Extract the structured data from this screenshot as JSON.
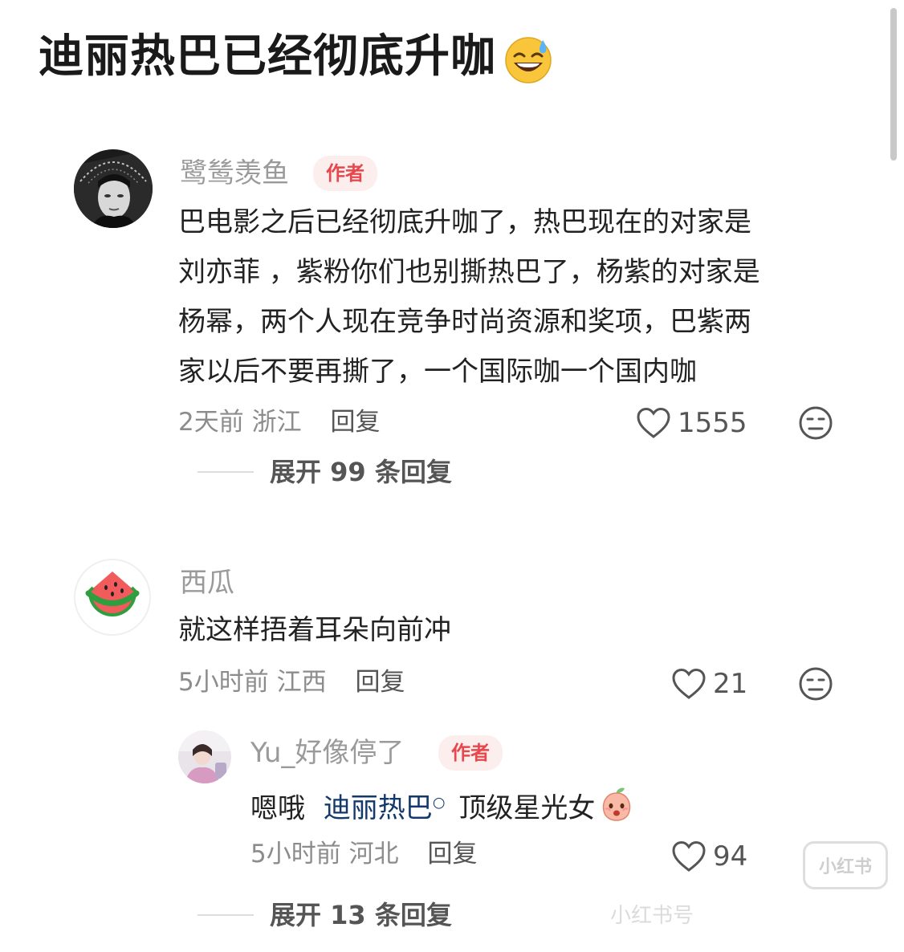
{
  "post": {
    "title": "迪丽热巴已经彻底升咖",
    "title_emoji": "sweat-smile-emoji"
  },
  "comments": [
    {
      "username": "鹭鸶羡鱼",
      "badge": "作者",
      "lines": [
        "巴电影之后已经彻底升咖了，热巴现在的对家是",
        "刘亦菲 ，紫粉你们也别撕热巴了，杨紫的对家是",
        "杨幂，两个人现在竞争时尚资源和奖项，巴紫两",
        "家以后不要再撕了，一个国际咖一个国内咖"
      ],
      "time": "2天前",
      "location": "浙江",
      "reply_label": "回复",
      "likes": "1555",
      "expand_label": "展开 99 条回复"
    },
    {
      "username": "西瓜",
      "text": "就这样捂着耳朵向前冲",
      "time": "5小时前",
      "location": "江西",
      "reply_label": "回复",
      "likes": "21",
      "reply": {
        "username": "Yu_好像停了",
        "badge": "作者",
        "prefix": "嗯哦",
        "mention": "迪丽热巴",
        "suffix": "顶级星光女",
        "time": "5小时前",
        "location": "河北",
        "reply_label": "回复",
        "likes": "94"
      },
      "expand_label": "展开 13 条回复"
    }
  ],
  "watermark": {
    "logo": "小红书",
    "text": "小红书号"
  },
  "colors": {
    "badge_bg": "#fdeeee",
    "badge_text": "#e5484d",
    "mention": "#13386c",
    "meta": "#8c8c8c"
  }
}
